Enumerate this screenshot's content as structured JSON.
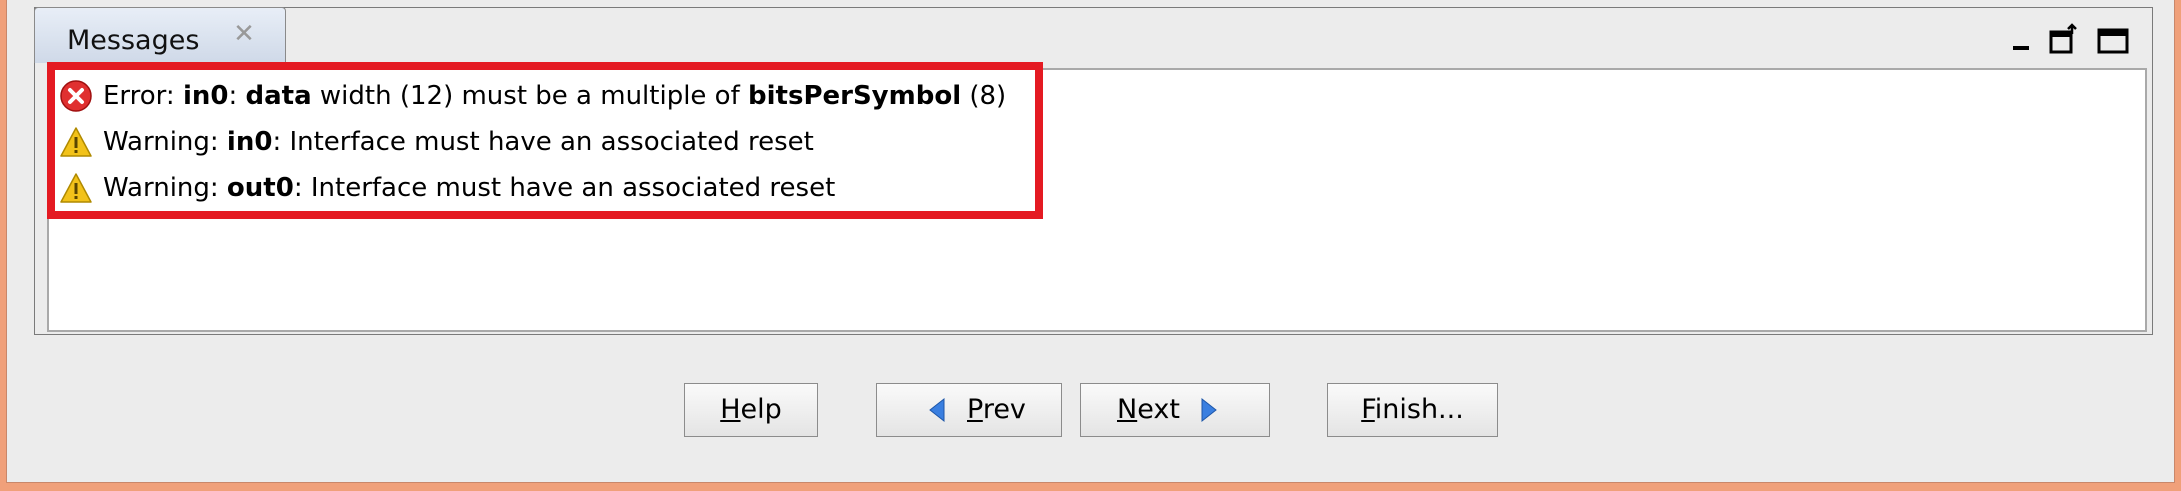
{
  "messages_panel": {
    "tab_label": "Messages",
    "messages": [
      {
        "type": "error",
        "prefix": "Error: ",
        "b1": "in0",
        "t1": ": ",
        "b2": "data",
        "t2": " width (12) must be a multiple of ",
        "b3": "bitsPerSymbol",
        "t3": " (8)"
      },
      {
        "type": "warning",
        "prefix": "Warning: ",
        "b1": "in0",
        "t1": ": Interface must have an associated reset"
      },
      {
        "type": "warning",
        "prefix": "Warning: ",
        "b1": "out0",
        "t1": ": Interface must have an associated reset"
      }
    ]
  },
  "buttons": {
    "help": {
      "mnemonic": "H",
      "rest": "elp"
    },
    "prev": {
      "mnemonic": "P",
      "rest": "rev"
    },
    "next": {
      "mnemonic": "N",
      "rest": "ext"
    },
    "finish": {
      "mnemonic": "F",
      "rest": "inish..."
    }
  },
  "colors": {
    "highlight": "#e41a22",
    "error_icon": "#e03030",
    "warning_icon": "#f2c21a",
    "arrow": "#3a7fe0",
    "frame": "#f0a07a"
  }
}
